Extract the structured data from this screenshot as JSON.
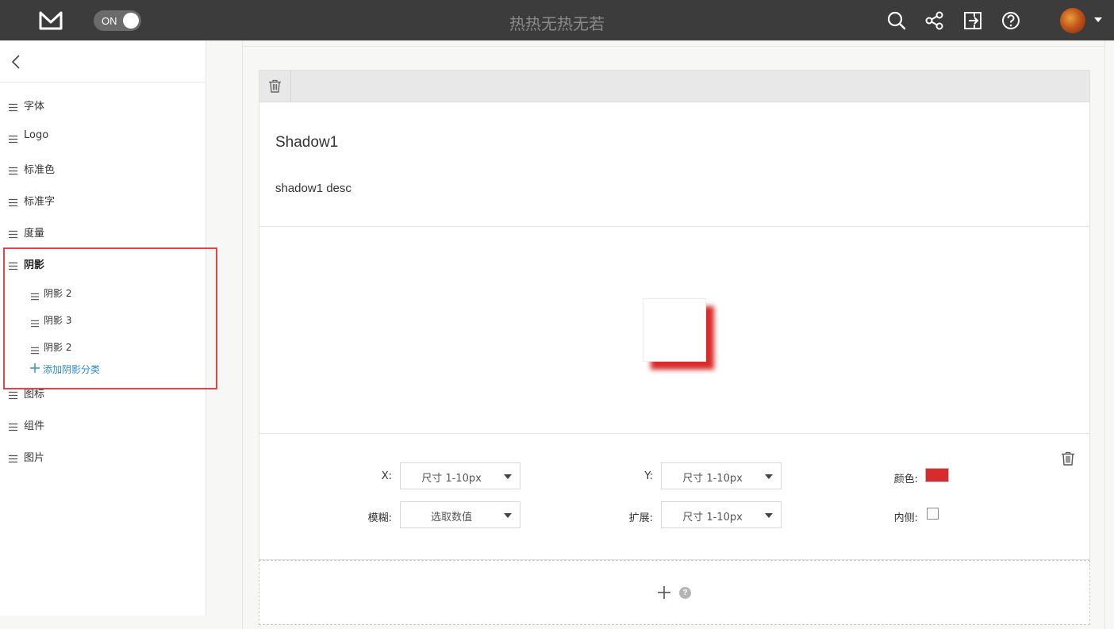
{
  "app": {
    "title": "热热无热无若",
    "toggle_label": "ON",
    "logo_icon": "mockplus-logo-icon",
    "toolbar_icons": [
      "search-icon",
      "share-icon",
      "export-icon",
      "help-icon"
    ],
    "avatar": "user-avatar"
  },
  "sidebar": {
    "back_icon": "chevron-left-icon",
    "items": [
      {
        "label": "字体"
      },
      {
        "label": "Logo"
      },
      {
        "label": "标准色"
      },
      {
        "label": "标准字"
      },
      {
        "label": "度量"
      },
      {
        "label": "阴影",
        "active": true
      },
      {
        "label": "图标"
      },
      {
        "label": "组件"
      },
      {
        "label": "图片"
      }
    ],
    "sub_items": [
      {
        "label": "阴影 2"
      },
      {
        "label": "阴影 3"
      },
      {
        "label": "阴影 2"
      }
    ],
    "add_category_label": "添加阴影分类",
    "highlight_color": "#e04646"
  },
  "card": {
    "name": "Shadow1",
    "description": "shadow1 desc",
    "shadow_color": "#d92b2b",
    "controls": {
      "x_label": "X:",
      "x_value": "尺寸 1-10px",
      "y_label": "Y:",
      "y_value": "尺寸 1-10px",
      "color_label": "颜色:",
      "color_value": "#d92b2b",
      "blur_label": "模糊:",
      "blur_value": "选取数值",
      "spread_label": "扩展:",
      "spread_value": "尺寸 1-10px",
      "inset_label": "内侧:",
      "inset_checked": false
    }
  },
  "add_zone": {
    "help_symbol": "?"
  }
}
